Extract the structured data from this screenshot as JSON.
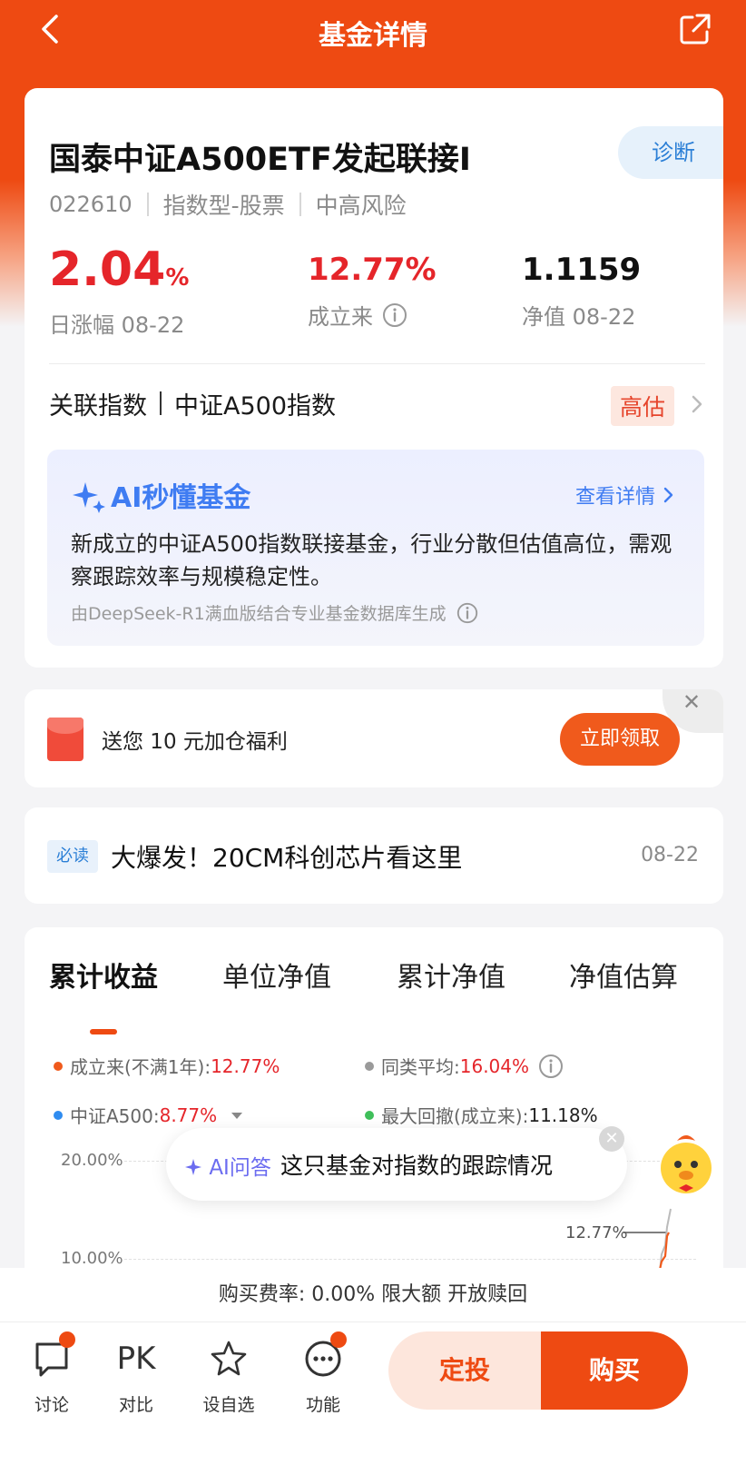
{
  "header": {
    "title": "基金详情",
    "accent": "#ee4a12"
  },
  "fund": {
    "name": "国泰中证A500ETF发起联接I",
    "diagnose": "诊断",
    "code": "022610",
    "type": "指数型-股票",
    "risk": "中高风险",
    "daily_change": "2.04",
    "daily_change_unit": "%",
    "daily_change_label": "日涨幅 08-22",
    "since_inception": "12.77%",
    "since_inception_label": "成立来",
    "nav": "1.1159",
    "nav_label": "净值 08-22"
  },
  "index": {
    "label": "关联指数",
    "name": "中证A500指数",
    "valuation": "高估"
  },
  "ai_summary": {
    "title": "AI秒懂基金",
    "detail_link": "查看详情",
    "body": "新成立的中证A500指数联接基金，行业分散但估值高位，需观察跟踪效率与规模稳定性。",
    "source": "由DeepSeek-R1满血版结合专业基金数据库生成"
  },
  "coupon": {
    "text": "送您 10 元加仓福利",
    "button": "立即领取"
  },
  "news": {
    "tag": "必读",
    "title": "大爆发！20CM科创芯片看这里",
    "date": "08-22"
  },
  "chart_tabs": [
    {
      "label": "累计收益",
      "active": true
    },
    {
      "label": "单位净值",
      "active": false
    },
    {
      "label": "累计净值",
      "active": false
    },
    {
      "label": "净值估算",
      "active": false
    }
  ],
  "legend": [
    {
      "name": "成立来(不满1年):",
      "value": "12.77%",
      "color": "#f05a1c"
    },
    {
      "name": "同类平均:",
      "value": "16.04%",
      "color": "#9a9a9a"
    },
    {
      "name": "中证A500:",
      "value": "8.77%",
      "color": "#2f8cf0"
    },
    {
      "name": "最大回撤(成立来):",
      "value": "11.18%",
      "color": "#3fbf5a"
    }
  ],
  "chart_data": {
    "type": "line",
    "y_ticks": [
      "20.00%",
      "10.00%"
    ],
    "annotation": "12.77%"
  },
  "ai_float": {
    "label": "AI问答",
    "question": "这只基金对指数的跟踪情况"
  },
  "fee_line": "购买费率: 0.00%  限大额  开放赎回",
  "bottom": {
    "discuss": "讨论",
    "pk_icon": "PK",
    "compare": "对比",
    "favorite": "设自选",
    "more": "功能",
    "sip": "定投",
    "buy": "购买"
  }
}
